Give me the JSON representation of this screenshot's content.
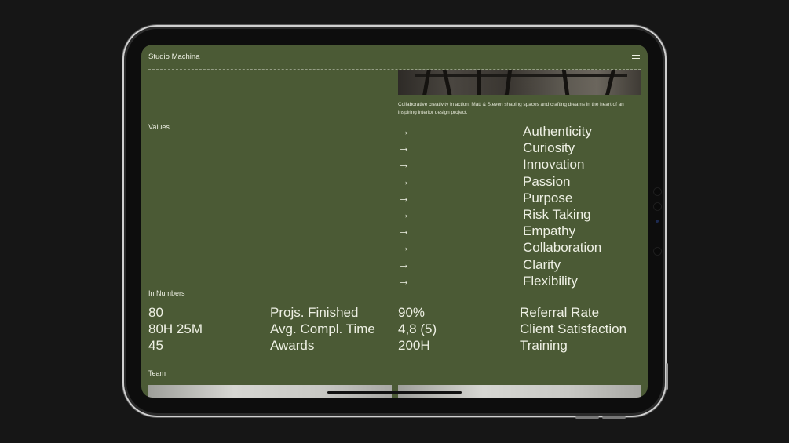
{
  "header": {
    "brand": "Studio Machina",
    "menu_icon": "hamburger-menu-icon"
  },
  "hero": {
    "caption": "Collaborative creativity in action: Matt & Steven shaping spaces and crafting dreams in the heart of an inspiring interior design project."
  },
  "values": {
    "label": "Values",
    "arrow_glyph": "→",
    "items": [
      "Authenticity",
      "Curiosity",
      "Innovation",
      "Passion",
      "Purpose",
      "Risk Taking",
      "Empathy",
      "Collaboration",
      "Clarity",
      "Flexibility"
    ]
  },
  "numbers": {
    "label": "In Numbers",
    "rows": [
      {
        "left_value": "80",
        "left_label": "Projs. Finished",
        "right_value": "90%",
        "right_label": "Referral Rate"
      },
      {
        "left_value": "80H 25M",
        "left_label": "Avg. Compl. Time",
        "right_value": "4,8 (5)",
        "right_label": "Client Satisfaction"
      },
      {
        "left_value": "45",
        "left_label": "Awards",
        "right_value": "200H",
        "right_label": "Training"
      }
    ]
  },
  "team": {
    "label": "Team"
  },
  "colors": {
    "page_background": "#161616",
    "screen_background": "#4b5a35",
    "text": "#eef0e4"
  }
}
